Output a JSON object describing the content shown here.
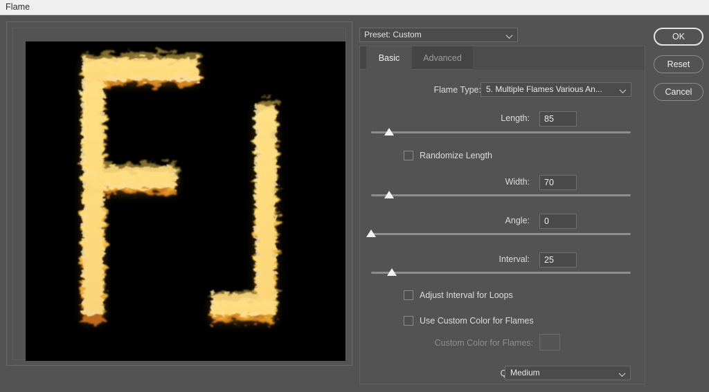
{
  "window": {
    "title": "Flame"
  },
  "preview": {
    "letters": "FJ",
    "background_color": "#000000",
    "flame_color_core": "#fff3b0",
    "flame_color_mid": "#f5c542",
    "flame_color_edge": "#d88a1e"
  },
  "preset": {
    "label": "Preset: Custom",
    "caret_icon": "chevron-down-icon"
  },
  "tabs": [
    {
      "label": "Basic",
      "active": true
    },
    {
      "label": "Advanced",
      "active": false
    }
  ],
  "fields": {
    "flame_type": {
      "label": "Flame Type:",
      "value": "5. Multiple Flames Various An...",
      "caret_icon": "chevron-down-icon"
    },
    "length": {
      "label": "Length:",
      "value": "85",
      "slider_percent": 7
    },
    "randomize_length": {
      "label": "Randomize Length",
      "checked": false
    },
    "width": {
      "label": "Width:",
      "value": "70",
      "slider_percent": 7
    },
    "angle": {
      "label": "Angle:",
      "value": "0",
      "slider_percent": 0
    },
    "interval": {
      "label": "Interval:",
      "value": "25",
      "slider_percent": 8
    },
    "adjust_interval_for_loops": {
      "label": "Adjust Interval for Loops",
      "checked": false
    },
    "use_custom_color": {
      "label": "Use Custom Color for Flames",
      "checked": false
    },
    "custom_color": {
      "label": "Custom Color for Flames:",
      "disabled": true,
      "swatch_color": "#555555"
    },
    "quality": {
      "label": "Quality:",
      "value": "Medium",
      "caret_icon": "chevron-down-icon"
    }
  },
  "buttons": {
    "ok": "OK",
    "reset": "Reset",
    "cancel": "Cancel"
  }
}
